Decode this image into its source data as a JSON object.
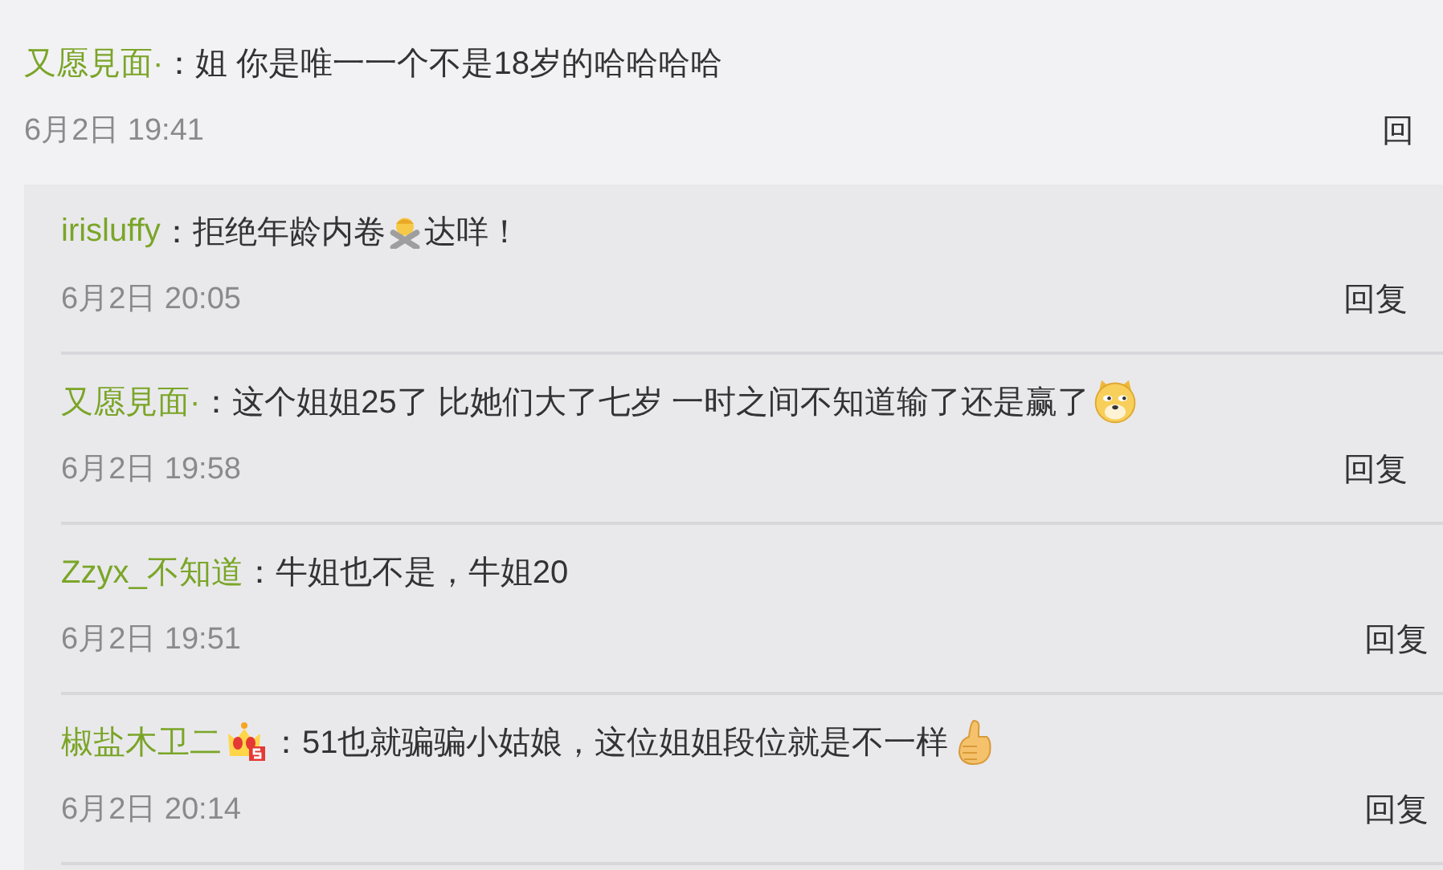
{
  "comment": {
    "author": "又愿見面·",
    "colon": "：",
    "text": "姐 你是唯一一个不是18岁的哈哈哈哈",
    "time": "6月2日 19:41",
    "reply": "回"
  },
  "replies": [
    {
      "author": "irisluffy",
      "colon": "：",
      "parts": [
        {
          "kind": "text",
          "text": "拒绝年龄内卷"
        },
        {
          "kind": "cross"
        },
        {
          "kind": "text",
          "text": "达咩！"
        }
      ],
      "time": "6月2日 20:05",
      "reply": "回复"
    },
    {
      "author": "又愿見面·",
      "colon": "：",
      "parts": [
        {
          "kind": "text",
          "text": "这个姐姐25了 比她们大了七岁 一时之间不知道输了还是赢了"
        },
        {
          "kind": "dog"
        }
      ],
      "time": "6月2日 19:58",
      "reply": "回复"
    },
    {
      "author": "Zzyx_不知道",
      "colon": "：",
      "parts": [
        {
          "kind": "text",
          "text": "牛姐也不是，牛姐20"
        }
      ],
      "time": "6月2日 19:51",
      "reply": "回复"
    },
    {
      "author": "椒盐木卫二",
      "vip_badge": true,
      "colon": "：",
      "parts": [
        {
          "kind": "text",
          "text": "51也就骗骗小姑娘，这位姐姐段位就是不一样"
        },
        {
          "kind": "thumb"
        }
      ],
      "time": "6月2日 20:14",
      "reply": "回复"
    }
  ]
}
